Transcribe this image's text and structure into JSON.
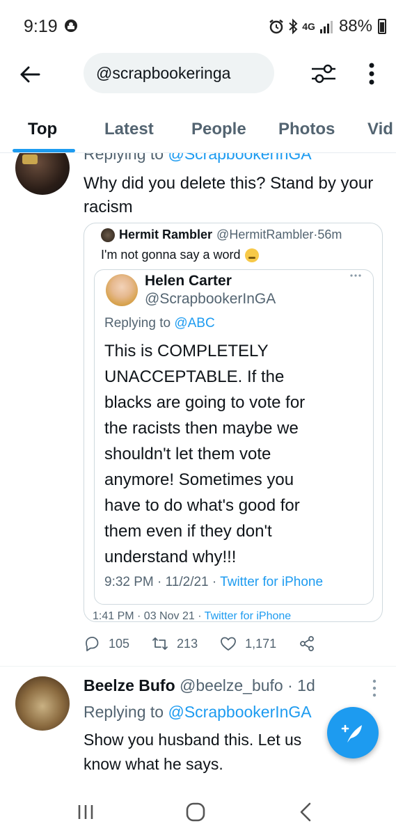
{
  "status_bar": {
    "time": "9:19",
    "network": "4G",
    "battery": "88%"
  },
  "search": {
    "query": "@scrapbookeringa"
  },
  "tabs": [
    {
      "label": "Top",
      "active": true
    },
    {
      "label": "Latest",
      "active": false
    },
    {
      "label": "People",
      "active": false
    },
    {
      "label": "Photos",
      "active": false
    },
    {
      "label": "Vid",
      "active": false
    }
  ],
  "tweet1": {
    "reply_prefix": "Replying to ",
    "reply_mention": "@ScrapbookerInGA",
    "text": "Why did you delete this? Stand by your racism",
    "quote": {
      "author_name": "Hermit Rambler",
      "author_handle": "@HermitRambler",
      "separator": " · ",
      "time": "56m",
      "text": "I'm not gonna say a word",
      "emoji": "zipper-mouth-face",
      "inner": {
        "author_name": "Helen Carter",
        "author_handle": "@ScrapbookerInGA",
        "reply_prefix": "Replying to ",
        "reply_mention": "@ABC",
        "text": "This is COMPLETELY UNACCEPTABLE. If the blacks are going to vote for the racists then maybe we shouldn't let them vote anymore! Sometimes you have to do what's good for them even if they don't understand why!!!",
        "timestamp": "9:32 PM · 11/2/21 · ",
        "source": "Twitter for iPhone"
      },
      "outer_timestamp": "1:41 PM · 03 Nov 21 · ",
      "outer_source": "Twitter for iPhone"
    },
    "actions": {
      "replies": "105",
      "retweets": "213",
      "likes": "1,171"
    }
  },
  "tweet2": {
    "author_name": "Beelze Bufo",
    "author_handle": "@beelze_bufo",
    "separator": " · ",
    "time": "1d",
    "reply_prefix": "Replying to ",
    "reply_mention": "@ScrapbookerInGA",
    "text": "Show you husband this. Let us know what he says."
  },
  "colors": {
    "accent": "#1d9bf0",
    "text": "#0f1419",
    "muted": "#536471"
  }
}
